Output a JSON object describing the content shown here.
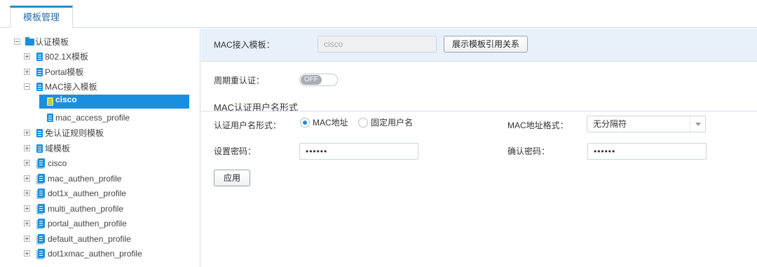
{
  "tabs": [
    {
      "label": "模板管理"
    }
  ],
  "tree": {
    "root": {
      "label": "认证模板"
    },
    "items": [
      {
        "label": "802.1X模板"
      },
      {
        "label": "Portal模板"
      },
      {
        "label": "MAC接入模板"
      },
      {
        "label": "cisco"
      },
      {
        "label": "mac_access_profile"
      },
      {
        "label": "免认证规则模板"
      },
      {
        "label": "域模板"
      },
      {
        "label": "cisco"
      },
      {
        "label": "mac_authen_profile"
      },
      {
        "label": "dot1x_authen_profile"
      },
      {
        "label": "multi_authen_profile"
      },
      {
        "label": "portal_authen_profile"
      },
      {
        "label": "default_authen_profile"
      },
      {
        "label": "dot1xmac_authen_profile"
      }
    ],
    "selected": "cisco"
  },
  "form": {
    "mac_template_label": "MAC接入模板：",
    "mac_template_value": "cisco",
    "show_relation_button": "展示模板引用关系",
    "reauth_label": "周期重认证：",
    "reauth_toggle": "OFF",
    "section_title": "MAC认证用户名形式",
    "username_form_label": "认证用户名形式：",
    "radio_mac": "MAC地址",
    "radio_fixed": "固定用户名",
    "mac_format_label": "MAC地址格式：",
    "mac_format_value": "无分隔符",
    "set_password_label": "设置密码：",
    "set_password_value": "••••••",
    "confirm_password_label": "确认密码：",
    "confirm_password_value": "••••••",
    "apply_button": "应用"
  },
  "colors": {
    "accent": "#1a8fe0",
    "header_band": "#e8f1f9",
    "border": "#d6dde3"
  }
}
